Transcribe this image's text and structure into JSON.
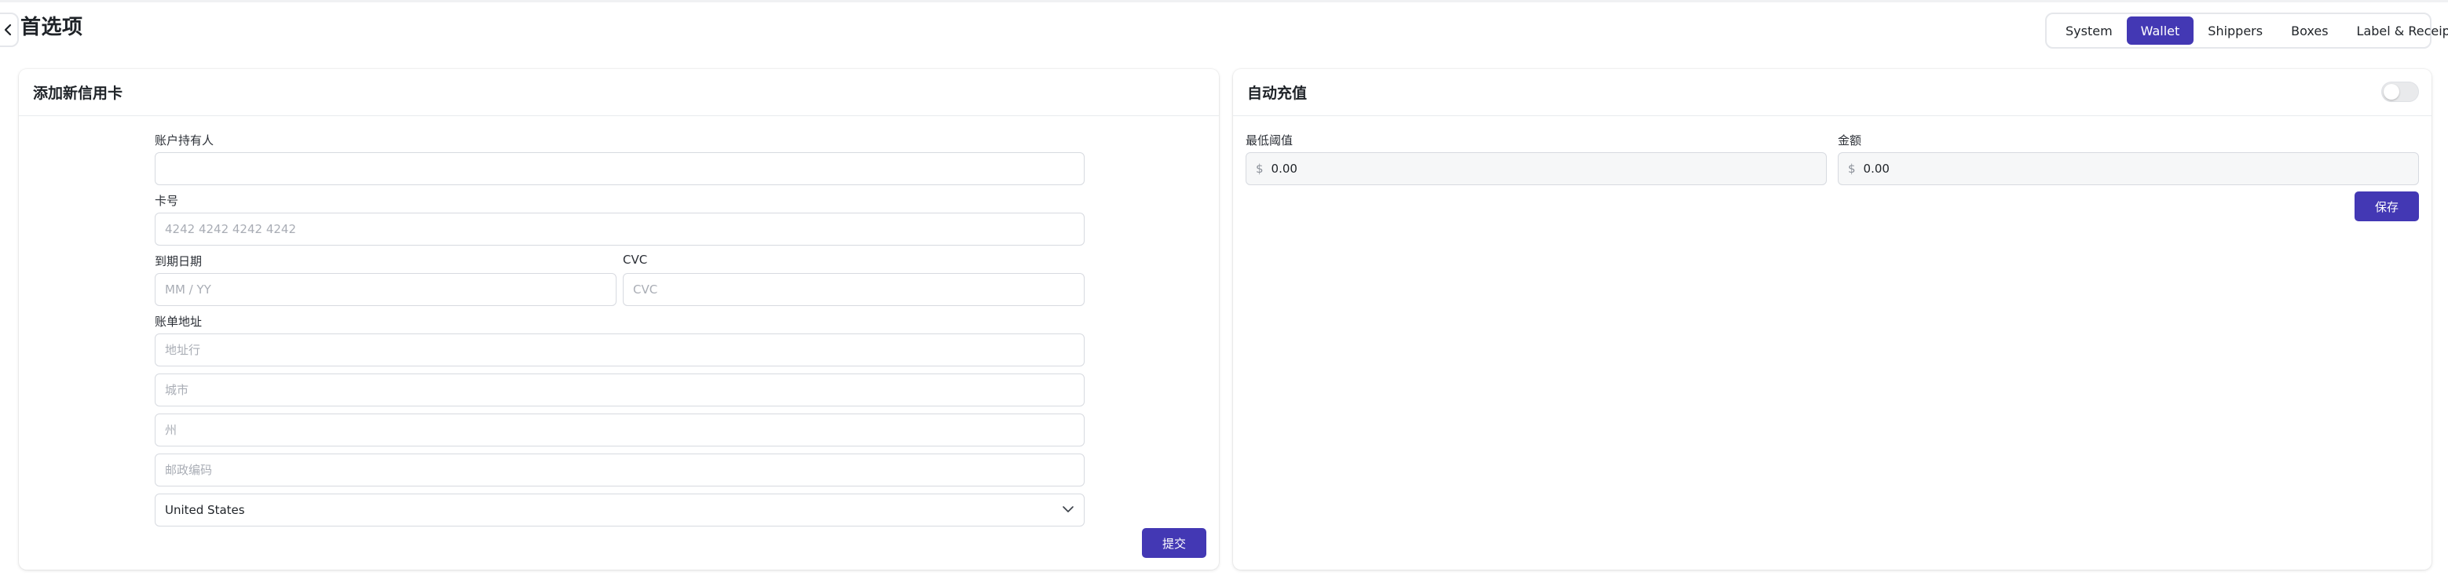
{
  "header": {
    "title": "首选项",
    "back_icon": "chevron-left-icon"
  },
  "tabs": [
    {
      "label": "System",
      "active": false
    },
    {
      "label": "Wallet",
      "active": true
    },
    {
      "label": "Shippers",
      "active": false
    },
    {
      "label": "Boxes",
      "active": false
    },
    {
      "label": "Label & Receipt",
      "active": false
    }
  ],
  "colors": {
    "accent": "#4338b4"
  },
  "add_card": {
    "title": "添加新信用卡",
    "account_holder_label": "账户持有人",
    "account_holder_value": "",
    "card_number_label": "卡号",
    "card_number_placeholder": "4242 4242 4242 4242",
    "expiry_label": "到期日期",
    "expiry_placeholder": "MM / YY",
    "cvc_label": "CVC",
    "cvc_placeholder": "CVC",
    "billing_label": "账单地址",
    "address_placeholder": "地址行",
    "city_placeholder": "城市",
    "state_placeholder": "州",
    "zip_placeholder": "邮政编码",
    "country_selected": "United States",
    "submit_label": "提交"
  },
  "auto_recharge": {
    "title": "自动充值",
    "enabled": false,
    "min_threshold_label": "最低阈值",
    "min_threshold_value": "0.00",
    "amount_label": "金额",
    "amount_value": "0.00",
    "currency_symbol": "$",
    "save_label": "保存"
  }
}
